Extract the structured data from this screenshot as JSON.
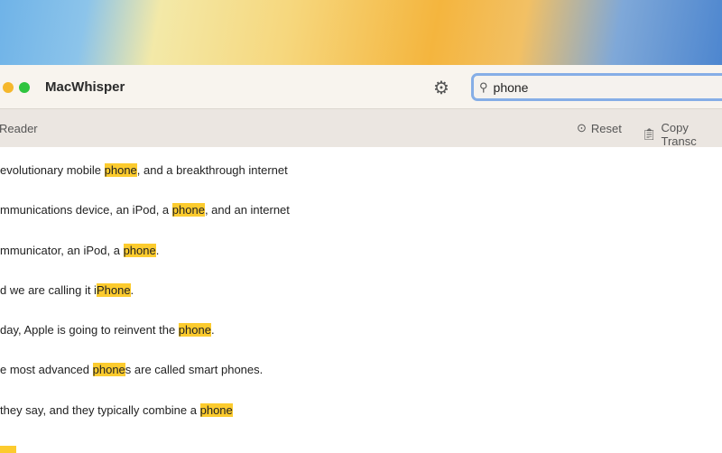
{
  "app": {
    "title": "MacWhisper"
  },
  "search": {
    "value": "phone"
  },
  "toolbar": {
    "reader_label": "Reader",
    "reset_label": "Reset",
    "copy_label": "Copy Transc"
  },
  "colors": {
    "highlight": "#fccb2e",
    "focus": "#86aee6"
  },
  "lines": [
    {
      "before": "evolutionary mobile ",
      "match": "phone",
      "after": ", and a breakthrough internet"
    },
    {
      "before": "mmunications device, an iPod, a ",
      "match": "phone",
      "after": ", and an internet"
    },
    {
      "before": "mmunicator, an iPod, a ",
      "match": "phone",
      "after": "."
    },
    {
      "before": "d we are calling it i",
      "match": "Phone",
      "after": "."
    },
    {
      "before": "day, Apple is going to reinvent the ",
      "match": "phone",
      "after": "."
    },
    {
      "before": "e most advanced ",
      "match": "phone",
      "after": "s are called smart phones."
    },
    {
      "before": " they say, and they typically combine a ",
      "match": "phone",
      "after": ""
    }
  ]
}
